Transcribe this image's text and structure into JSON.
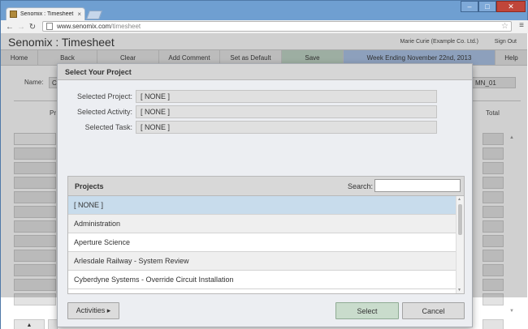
{
  "browser": {
    "tab_title": "Senomix : Timesheet",
    "tab_close": "×",
    "url_host": "www.senomix.com",
    "url_path": "/timesheet"
  },
  "app": {
    "title": "Senomix : Timesheet",
    "user": "Marie Curie  (Example Co. Ltd.)",
    "signout": "Sign Out"
  },
  "menubar": {
    "home": "Home",
    "back": "Back",
    "clear": "Clear",
    "add_comment": "Add Comment",
    "set_default": "Set as Default",
    "save": "Save",
    "week": "Week Ending November 22nd, 2013",
    "help": "Help"
  },
  "background": {
    "name_label": "Name:",
    "name_value": "C",
    "id_value": "MN_01",
    "col_left": "Pr",
    "col_total": "Total",
    "up_button": "▲"
  },
  "dialog": {
    "title": "Select Your Project",
    "selected_project_label": "Selected Project:",
    "selected_project_value": "[ NONE ]",
    "selected_activity_label": "Selected Activity:",
    "selected_activity_value": "[ NONE ]",
    "selected_task_label": "Selected Task:",
    "selected_task_value": "[ NONE ]",
    "list_header": "Projects",
    "search_label": "Search:",
    "search_value": "",
    "projects": [
      "[ NONE ]",
      "Administration",
      "Aperture Science",
      "Arlesdale Railway - System Review",
      "Cyberdyne Systems - Override Circuit Installation"
    ],
    "activities_button": "Activities ▸",
    "select_button": "Select",
    "cancel_button": "Cancel"
  },
  "colors": {
    "save_bg": "#bed4c4",
    "week_bg": "#a9c2e6",
    "selected_row": "#c8dcec",
    "select_button": "#c9dccc"
  },
  "icons": [
    "page-icon",
    "back-icon",
    "forward-icon",
    "reload-icon",
    "star-icon",
    "menu-icon",
    "minimize-icon",
    "maximize-icon",
    "close-icon"
  ]
}
